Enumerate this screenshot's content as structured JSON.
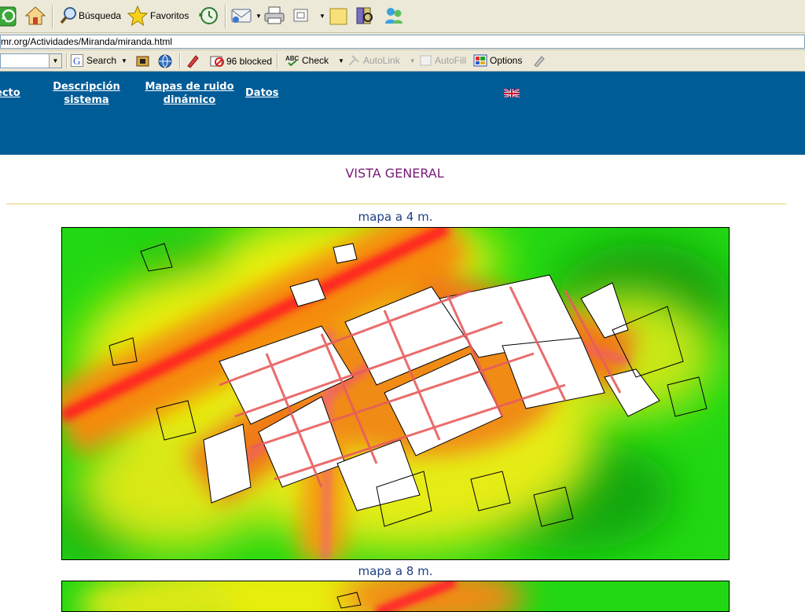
{
  "toolbar": {
    "search_label": "Búsqueda",
    "favorites_label": "Favoritos"
  },
  "address": {
    "url": "mr.org/Actividades/Miranda/miranda.html"
  },
  "links_bar": {
    "search_label": "Search",
    "blocked_label": "96 blocked",
    "check_label": "Check",
    "autolink_label": "AutoLink",
    "autofill_label": "AutoFill",
    "options_label": "Options"
  },
  "nav": {
    "proyecto": "ecto",
    "descripcion_line1": "Descripción",
    "descripcion_line2": "sistema",
    "mapas_line1": "Mapas de ruido",
    "mapas_line2": "dinámico",
    "datos": "Datos"
  },
  "content": {
    "title": "VISTA GENERAL",
    "map1_caption": "mapa a 4 m.",
    "map2_caption": "mapa a 8 m."
  },
  "colors": {
    "header_bg": "#005c97",
    "title": "#7a1a78",
    "caption": "#1f3f80",
    "rule": "#e8d46e"
  }
}
